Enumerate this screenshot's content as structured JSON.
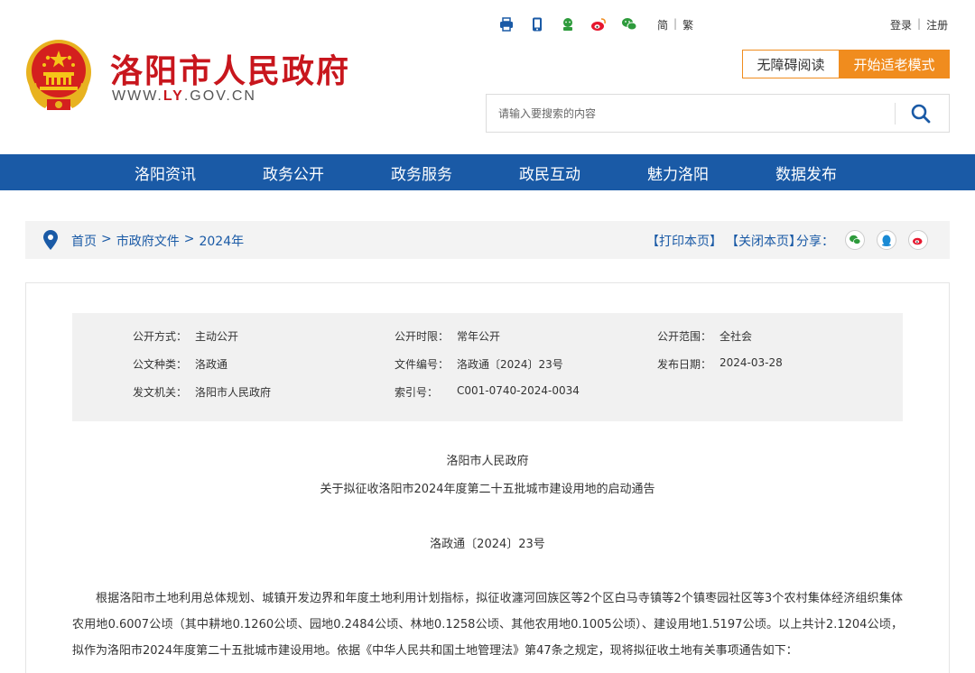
{
  "header": {
    "site_title": "洛阳市人民政府",
    "site_url_prefix": "WWW.",
    "site_url_ly": "LY",
    "site_url_suffix": ".GOV.CN",
    "top_icons": [
      "printer-icon",
      "mobile-icon",
      "wechat-mp-icon",
      "weibo-icon",
      "wechat-icon"
    ],
    "lang_simplified": "简",
    "lang_traditional": "繁",
    "login": "登录",
    "register": "注册",
    "accessible_read": "无障碍阅读",
    "elder_mode": "开始适老模式",
    "search_placeholder": "请输入要搜索的内容"
  },
  "nav": {
    "items": [
      "洛阳资讯",
      "政务公开",
      "政务服务",
      "政民互动",
      "魅力洛阳",
      "数据发布"
    ]
  },
  "breadcrumb": {
    "items": [
      "首页",
      "市政府文件",
      "2024年"
    ],
    "separator": ">",
    "print": "【打印本页】",
    "close": "【关闭本页】",
    "share_label": "分享："
  },
  "meta": {
    "open_mode_k": "公开方式：",
    "open_mode_v": "主动公开",
    "open_period_k": "公开时限：",
    "open_period_v": "常年公开",
    "open_scope_k": "公开范围：",
    "open_scope_v": "全社会",
    "doc_type_k": "公文种类：",
    "doc_type_v": "洛政通",
    "doc_no_k": "文件编号：",
    "doc_no_v": "洛政通〔2024〕23号",
    "pub_date_k": "发布日期：",
    "pub_date_v": "2024-03-28",
    "issuer_k": "发文机关：",
    "issuer_v": "洛阳市人民政府",
    "index_k": "索引号：",
    "index_v": "C001-0740-2024-0034"
  },
  "document": {
    "org": "洛阳市人民政府",
    "title": "关于拟征收洛阳市2024年度第二十五批城市建设用地的启动通告",
    "number": "洛政通〔2024〕23号",
    "body": "根据洛阳市土地利用总体规划、城镇开发边界和年度土地利用计划指标，拟征收瀍河回族区等2个区白马寺镇等2个镇枣园社区等3个农村集体经济组织集体农用地0.6007公顷（其中耕地0.1260公顷、园地0.2484公顷、林地0.1258公顷、其他农用地0.1005公顷）、建设用地1.5197公顷。以上共计2.1204公顷，拟作为洛阳市2024年度第二十五批城市建设用地。依据《中华人民共和国土地管理法》第47条之规定，现将拟征收土地有关事项通告如下："
  },
  "colors": {
    "brand_red": "#c8161d",
    "nav_blue": "#1a5aa6",
    "accent_orange": "#f08c1e"
  }
}
